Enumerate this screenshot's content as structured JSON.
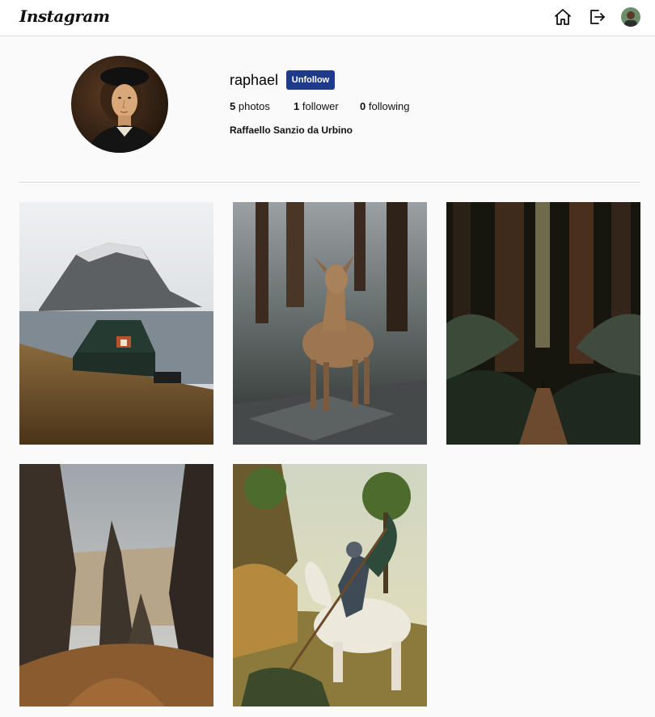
{
  "header": {
    "logo": "Instagram",
    "icons": [
      "home-icon",
      "logout-icon",
      "user-avatar"
    ]
  },
  "profile": {
    "username": "raphael",
    "follow_button": "Unfollow",
    "stats": {
      "photos_count": "5",
      "photos_label": "photos",
      "followers_count": "1",
      "followers_label": "follower",
      "following_count": "0",
      "following_label": "following"
    },
    "full_name": "Raffaello Sanzio da Urbino"
  },
  "photos": [
    {
      "subject": "island-cabin"
    },
    {
      "subject": "deer"
    },
    {
      "subject": "forest-path"
    },
    {
      "subject": "rock-pinnacles"
    },
    {
      "subject": "saint-george-painting"
    }
  ],
  "colors": {
    "button": "#1e3a8a",
    "background": "#fafafa",
    "divider": "#dbdbdb"
  }
}
